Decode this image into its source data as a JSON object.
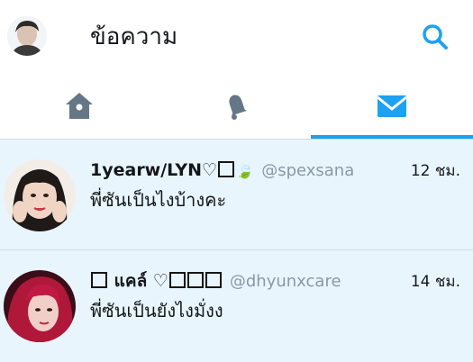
{
  "header": {
    "title": "ข้อความ",
    "avatar_icon": "user-avatar-icon",
    "search_icon": "search-icon"
  },
  "tabs": [
    {
      "name": "home",
      "icon": "home-icon",
      "active": false
    },
    {
      "name": "notifications",
      "icon": "bell-icon",
      "active": false
    },
    {
      "name": "messages",
      "icon": "envelope-icon",
      "active": true
    }
  ],
  "colors": {
    "accent": "#1da1f2",
    "icon_gray": "#657786",
    "row_bg": "#e8f5fd",
    "handle": "#8899a6"
  },
  "conversations": [
    {
      "name": "1yearw/LYN♡",
      "name_suffix": "🍃",
      "handle": "@spexsana",
      "time": "12 ชม.",
      "message": "พี่ซันเป็นไงบ้างคะ"
    },
    {
      "name_prefix": "แคล์ ♡",
      "handle": "@dhyunxcare",
      "time": "14 ชม.",
      "message": "พี่ซันเป็นยังไงมั่งง"
    }
  ]
}
